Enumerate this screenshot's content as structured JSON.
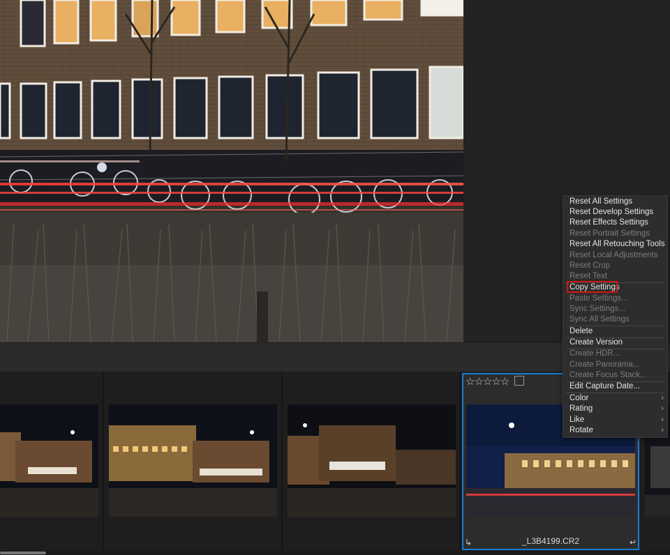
{
  "colors": {
    "selection_border": "#1b7bd6",
    "highlight_box": "#d41414",
    "menu_bg": "#2d2d2d",
    "app_bg": "#262626"
  },
  "filmstrip": {
    "selected_file": "_L3B4199.CR2",
    "selected_stars": "☆☆☆☆☆",
    "corner_left": "↳",
    "corner_right": "↵"
  },
  "context_menu": {
    "items": [
      {
        "label": "Reset All Settings",
        "enabled": true
      },
      {
        "label": "Reset Develop Settings",
        "enabled": true
      },
      {
        "label": "Reset Effects Settings",
        "enabled": true
      },
      {
        "label": "Reset Portrait Settings",
        "enabled": false
      },
      {
        "label": "Reset All Retouching Tools",
        "enabled": true
      },
      {
        "label": "Reset Local Adjustments",
        "enabled": false
      },
      {
        "label": "Reset Crop",
        "enabled": false
      },
      {
        "label": "Reset Text",
        "enabled": false
      },
      {
        "label": "Copy Settings",
        "enabled": true
      },
      {
        "label": "Paste Settings...",
        "enabled": false
      },
      {
        "label": "Sync Settings...",
        "enabled": false
      },
      {
        "label": "Sync All Settings",
        "enabled": false
      },
      {
        "label": "Delete",
        "enabled": true
      },
      {
        "label": "Create Version",
        "enabled": true
      },
      {
        "label": "Create HDR...",
        "enabled": false
      },
      {
        "label": "Create Panorama...",
        "enabled": false
      },
      {
        "label": "Create Focus Stack...",
        "enabled": false
      },
      {
        "label": "Edit Capture Date...",
        "enabled": true
      },
      {
        "label": "Color",
        "enabled": true,
        "submenu": true
      },
      {
        "label": "Rating",
        "enabled": true,
        "submenu": true
      },
      {
        "label": "Like",
        "enabled": true,
        "submenu": true
      },
      {
        "label": "Rotate",
        "enabled": true,
        "submenu": true
      }
    ],
    "submenu_arrow": "›"
  }
}
